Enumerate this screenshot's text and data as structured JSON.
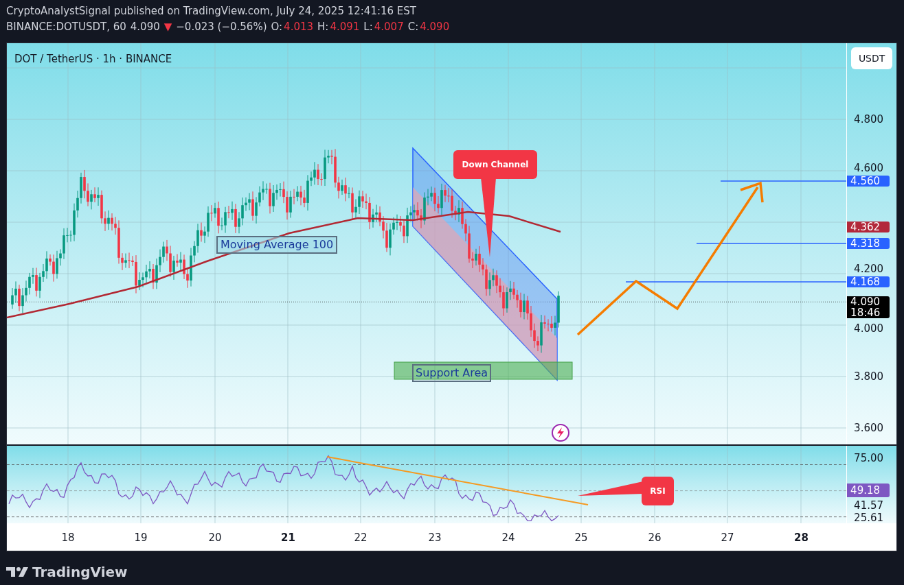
{
  "header": {
    "byline": "CryptoAnalystSignal published on TradingView.com, July 24, 2025 12:41:16 EST",
    "symbol": "BINANCE:DOTUSDT, 60",
    "last": "4.090",
    "change_icon": "▼",
    "change": "−0.023 (−0.56%)",
    "ohlc": [
      {
        "label": "O:",
        "value": "4.013"
      },
      {
        "label": "H:",
        "value": "4.091"
      },
      {
        "label": "L:",
        "value": "4.007"
      },
      {
        "label": "C:",
        "value": "4.090"
      }
    ]
  },
  "chart": {
    "title": "DOT / TetherUS · 1h · BINANCE",
    "currency": "USDT",
    "price_ticks": [
      "4.800",
      "4.600",
      "4.200",
      "4.000",
      "3.800",
      "3.600"
    ],
    "price_labels": [
      {
        "value": "4.560",
        "color": "#2962ff"
      },
      {
        "value": "4.362",
        "color": "#b2283a"
      },
      {
        "value": "4.318",
        "color": "#2962ff"
      },
      {
        "value": "4.168",
        "color": "#2962ff"
      },
      {
        "value": "4.090",
        "sub": "18:46",
        "color": "#000000"
      }
    ],
    "ma_label": "Moving Average 100",
    "support_label": "Support Area",
    "channel_callout": "Down Channel"
  },
  "rsi": {
    "ticks": [
      "75.00",
      "41.57",
      "25.61"
    ],
    "value": "49.18",
    "callout": "RSI"
  },
  "x_axis": [
    {
      "label": "18",
      "bold": false
    },
    {
      "label": "19",
      "bold": false
    },
    {
      "label": "20",
      "bold": false
    },
    {
      "label": "21",
      "bold": true
    },
    {
      "label": "22",
      "bold": false
    },
    {
      "label": "23",
      "bold": false
    },
    {
      "label": "24",
      "bold": false
    },
    {
      "label": "25",
      "bold": false
    },
    {
      "label": "26",
      "bold": false
    },
    {
      "label": "27",
      "bold": false
    },
    {
      "label": "28",
      "bold": true
    }
  ],
  "footer": {
    "brand": "TradingView"
  }
}
